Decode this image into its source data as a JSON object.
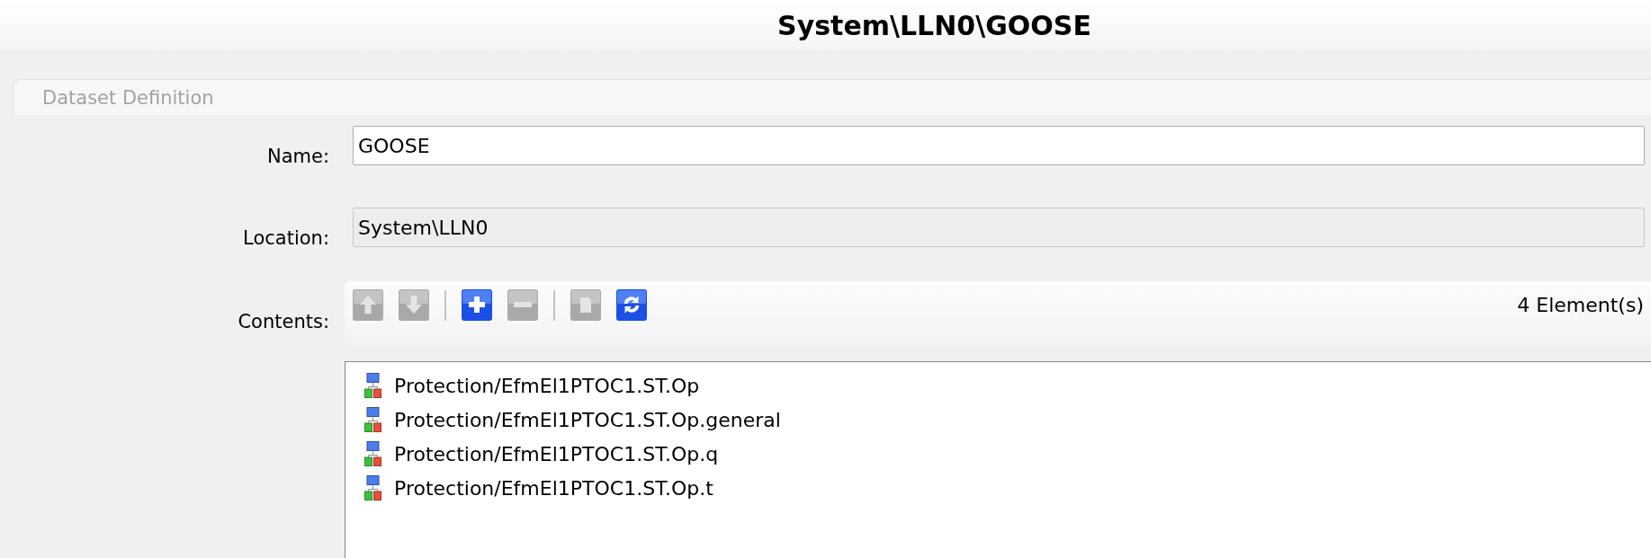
{
  "window": {
    "title": "System\\LLN0\\GOOSE"
  },
  "group": {
    "title": "Dataset Definition"
  },
  "fields": [
    {
      "label": "Name:",
      "value": "GOOSE",
      "disabled": false
    },
    {
      "label": "Location:",
      "value": "System\\LLN0",
      "disabled": true
    }
  ],
  "contents": {
    "label": "Contents:",
    "toolbar": [
      {
        "kind": "up",
        "disabled": true
      },
      {
        "kind": "down",
        "disabled": true
      },
      {
        "kind": "separator"
      },
      {
        "kind": "add",
        "disabled": false
      },
      {
        "kind": "remove",
        "disabled": true
      },
      {
        "kind": "separator"
      },
      {
        "kind": "paste",
        "disabled": true
      },
      {
        "kind": "refresh",
        "disabled": false
      }
    ],
    "count": "4 Element(s)",
    "items": [
      {
        "label": "Protection/EfmEl1PTOC1.ST.Op",
        "selected": false
      },
      {
        "label": "Protection/EfmEl1PTOC1.ST.Op.general",
        "selected": false
      },
      {
        "label": "Protection/EfmEl1PTOC1.ST.Op.q",
        "selected": false
      },
      {
        "label": "Protection/EfmEl1PTOC1.ST.Op.t",
        "selected": false
      }
    ]
  }
}
